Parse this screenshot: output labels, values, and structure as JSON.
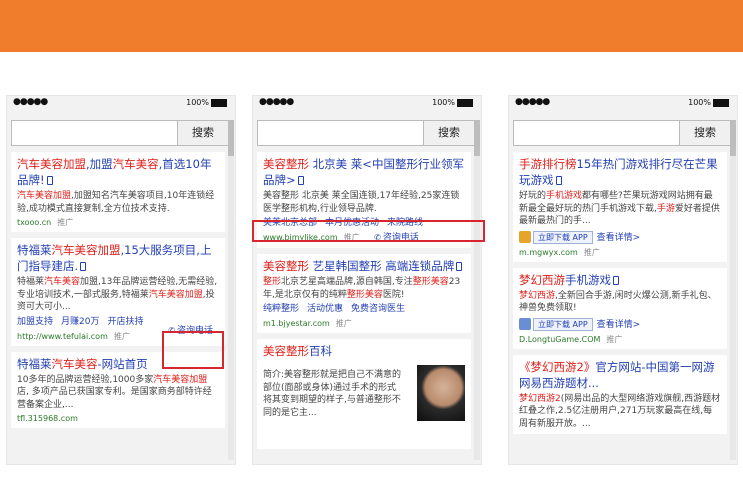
{
  "status": {
    "signal": "●●●●●",
    "battery": "100%"
  },
  "search": {
    "button": "搜索"
  },
  "phone1": {
    "r1": {
      "title_a": "汽车美容加盟",
      "title_b": ",加盟",
      "title_c": "汽车美容",
      "title_d": ",首选10年品牌!",
      "desc_a": "汽车美容加盟",
      "desc_b": ",加盟知名汽车美容项目,10年连锁经验,成功模式直接复制,全方位技术支持.",
      "url": "txooo.cn",
      "ad": "推广"
    },
    "r2": {
      "title_a": "特福莱",
      "title_b": "汽车美容加盟",
      "title_c": ",15大服务项目,上门指导建店.",
      "desc_a": "特福莱",
      "desc_b": "汽车美容",
      "desc_c": "加盟,13年品牌运营经验,无需经验,专业培训技术,一部式服务,特福莱",
      "desc_d": "汽车美容加盟",
      "desc_e": ",投资可大可小...",
      "links": [
        "加盟支持",
        "月赚20万",
        "开店扶持"
      ],
      "url": "http://www.tefulai.com",
      "ad": "推广",
      "call": "咨询电话"
    },
    "r3": {
      "title_a": "特福莱",
      "title_b": "汽车美容",
      "title_c": "-网站首页",
      "desc_a": "10多年的品牌运营经验,1000多家",
      "desc_b": "汽车美容加盟",
      "desc_c": "店, 多项产品已获国家专利。是国家商务部特许经营备案企业,...",
      "url": "tfl.315968.com"
    }
  },
  "phone2": {
    "r1": {
      "title_a": "美容整形",
      "title_b": " 北京美 莱<中国整形行业领军品牌>",
      "desc": "美容整形 北京美 莱全国连锁,17年经验,25家连锁医学整形机构,行业领导品牌.",
      "links": [
        "美莱北京总部",
        "本月优惠活动",
        "来院路线"
      ],
      "url": "www.bjmylike.com",
      "ad": "推广",
      "call": "咨询电话"
    },
    "r2": {
      "title_a": "美容整形",
      "title_b": " 艺星韩国整形 高端连锁品牌",
      "desc_a": "整形",
      "desc_b": "北京艺星高端品牌,源自韩国,专注",
      "desc_c": "整形美容",
      "desc_d": "23年,是北京仅有的纯粹",
      "desc_e": "整形美容",
      "desc_f": "医院!",
      "links": [
        "纯粹整形",
        "活动优惠",
        "免费咨询医生"
      ],
      "url": "m1.bjyestar.com",
      "ad": "推广"
    },
    "r3": {
      "title_a": "美容整形",
      "title_b": "百科",
      "desc": "简介:美容整形就是把自己不满意的部位(面部或身体)通过手术的形式将其变到期望的样子,与普通整形不同的是它主..."
    }
  },
  "phone3": {
    "r1": {
      "title_a": "手游排行榜",
      "title_b": "15年热门游戏排行尽在芒果玩游戏",
      "desc_a": "好玩的",
      "desc_b": "手机游戏",
      "desc_c": "都有哪些?芒果玩游戏网站拥有最新最全最好玩的热门手机游戏下载,",
      "desc_d": "手游",
      "desc_e": "爱好者提供最新最热门的手...",
      "download": "立即下载 APP",
      "more": "查看详情>",
      "url": "m.mgwyx.com",
      "ad": "推广"
    },
    "r2": {
      "title_a": "梦幻西游",
      "title_b": "手机游戏",
      "desc_a": "梦幻西游",
      "desc_b": ",全新回合手游,闲时火爆公测,新手礼包、神兽免费领取!",
      "download": "立即下载 APP",
      "more": "查看详情>",
      "url": "D.LongtuGame.COM",
      "ad": "推广"
    },
    "r3": {
      "title_a": "《梦幻西游2》",
      "title_b": "官方网站-中国第一网游网易西游题材...",
      "desc_a": "梦幻西游2",
      "desc_b": "(网易出品的大型网络游戏旗舰,西游题材红叠之作,2.5亿注册用户,271万玩家最高在线,每周有新服开放。..."
    }
  },
  "colors": {
    "accent": "#ef7d2c",
    "highlight_box": "#d8262e",
    "link": "#2440b3",
    "keyword": "#e0201b"
  }
}
